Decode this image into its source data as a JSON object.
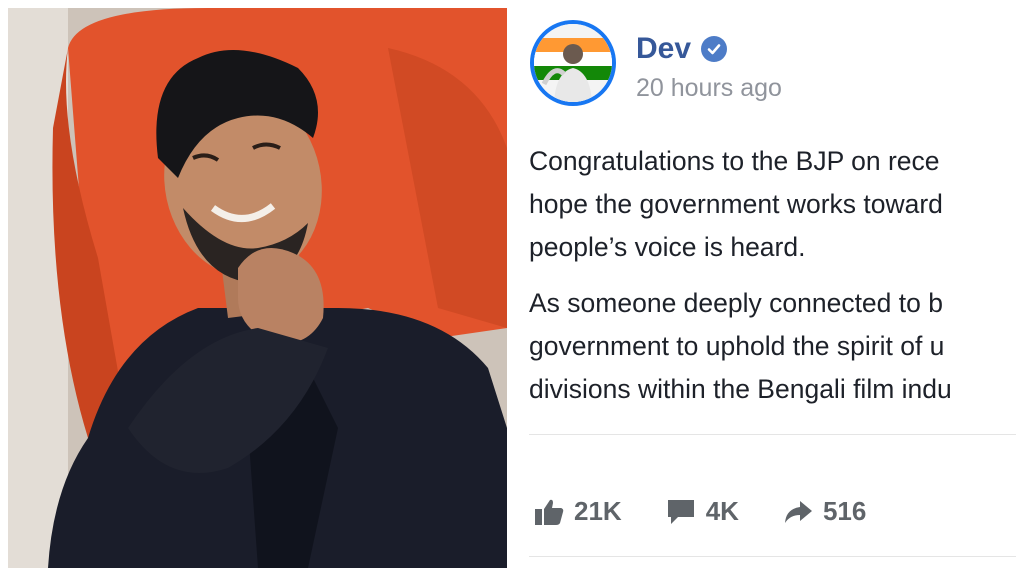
{
  "photo": {
    "alt": "Portrait of a smiling man"
  },
  "post": {
    "author": "Dev",
    "verified_icon": "verified-check-icon",
    "timestamp": "20 hours ago",
    "paragraphs": [
      [
        "Congratulations to the BJP on rece",
        "hope the government works toward",
        "people’s voice is heard."
      ],
      [
        "As someone deeply connected to b",
        "government to uphold the spirit of u",
        "divisions within the Bengali film indu"
      ]
    ],
    "stats": {
      "likes": "21K",
      "comments": "4K",
      "shares": "516"
    }
  },
  "colors": {
    "author": "#365899",
    "verified": "#4d7cc7",
    "avatar_border": "#1877f2",
    "muted": "#90949c",
    "text": "#1d2129",
    "icon": "#5f6469",
    "chair": "#e2532c"
  }
}
